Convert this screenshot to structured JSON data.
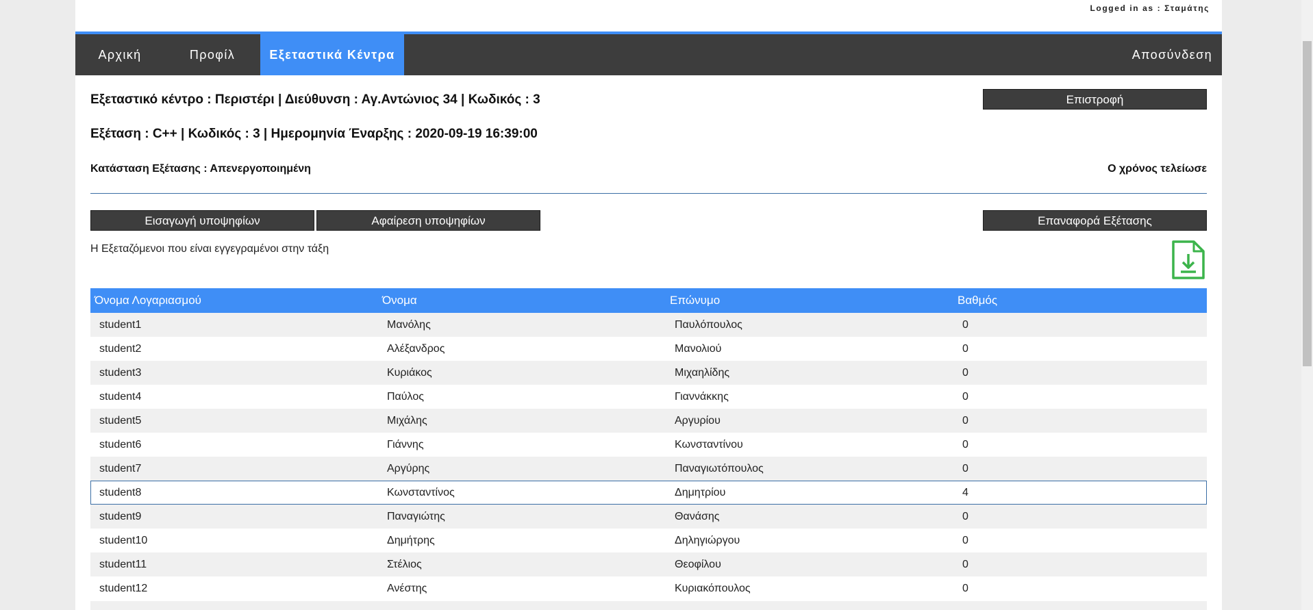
{
  "header": {
    "login_text": "Logged in as : Σταμάτης"
  },
  "nav": {
    "items": [
      "Αρχική",
      "Προφίλ",
      "Εξεταστικά Κέντρα"
    ],
    "logout": "Αποσύνδεση"
  },
  "info": {
    "center_line": "Εξεταστικό κέντρο : Περιστέρι | Διεύθυνση : Αγ.Αντώνιος 34 | Κωδικός : 3",
    "exam_line": "Εξέταση : C++ | Κωδικός : 3 | Ημερομηνία Έναρξης : 2020-09-19 16:39:00",
    "status_line": "Κατάσταση Εξέτασης : Απενεργοποιημένη",
    "time_status": "Ο χρόνος τελείωσε"
  },
  "buttons": {
    "back": "Επιστροφή",
    "add_candidates": "Εισαγωγή υποψηφίων",
    "remove_candidates": "Αφαίρεση υποψηφίων",
    "reset_exam": "Επαναφορά Εξέτασης"
  },
  "note": "Η Εξεταζόμενοι που είναι εγγεγραμένοι στην τάξη",
  "table": {
    "headers": [
      "Όνομα Λογαριασμού",
      "Όνομα",
      "Επώνυμο",
      "Βαθμός"
    ],
    "rows": [
      [
        "student1",
        "Μανόλης",
        "Παυλόπουλος",
        "0"
      ],
      [
        "student2",
        "Αλέξανδρος",
        "Μανολιού",
        "0"
      ],
      [
        "student3",
        "Κυριάκος",
        "Μιχαηλίδης",
        "0"
      ],
      [
        "student4",
        "Παύλος",
        "Γιαννάκκης",
        "0"
      ],
      [
        "student5",
        "Μιχάλης",
        "Αργυρίου",
        "0"
      ],
      [
        "student6",
        "Γιάννης",
        "Κωνσταντίνου",
        "0"
      ],
      [
        "student7",
        "Αργύρης",
        "Παναγιωτόπουλος",
        "0"
      ],
      [
        "student8",
        "Κωνσταντίνος",
        "Δημητρίου",
        "4"
      ],
      [
        "student9",
        "Παναγιώτης",
        "Θανάσης",
        "0"
      ],
      [
        "student10",
        "Δημήτρης",
        "Δηληγιώργου",
        "0"
      ],
      [
        "student11",
        "Στέλιος",
        "Θεοφίλου",
        "0"
      ],
      [
        "student12",
        "Ανέστης",
        "Κυριακόπουλος",
        "0"
      ]
    ]
  },
  "colors": {
    "accent": "#3f8ef6",
    "nav_bg": "#3d3d3d",
    "download_icon": "#3cb44b"
  },
  "icons": {
    "download": "file-download-icon"
  }
}
